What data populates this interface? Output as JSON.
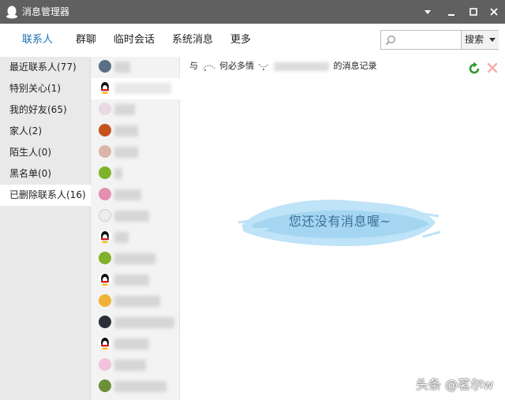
{
  "window": {
    "title": "消息管理器"
  },
  "nav": {
    "tabs": [
      "联系人",
      "群聊",
      "临时会话",
      "系统消息",
      "更多"
    ],
    "search_placeholder": "",
    "search_button": "搜索"
  },
  "sidebar": {
    "items": [
      "最近联系人(77)",
      "特别关心(1)",
      "我的好友(65)",
      "家人(2)",
      "陌生人(0)",
      "黑名单(0)",
      "已删除联系人(16)"
    ]
  },
  "main": {
    "header_prefix": "与",
    "header_name": "何必多情",
    "header_suffix": "的消息记录",
    "empty_message": "您还没有消息喔~"
  },
  "watermark": "头条 @茗尔w",
  "colors": {
    "titlebar": "#606060",
    "active_tab": "#1a6fb4",
    "sidebar_bg": "#e9e9e9",
    "empty_cloud": "#a9d8f3"
  }
}
